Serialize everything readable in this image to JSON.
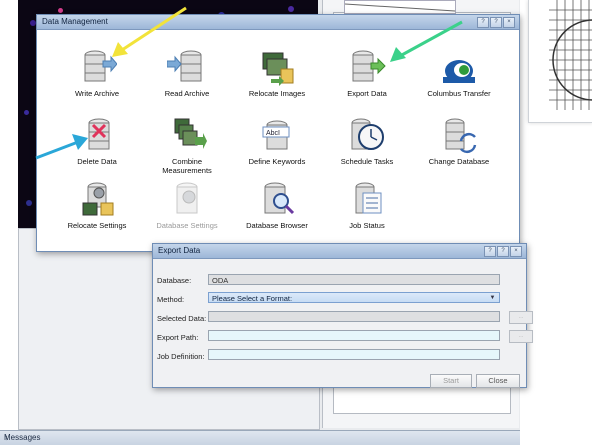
{
  "messages_bar": {
    "label": "Messages",
    "pin": "↑"
  },
  "data_management": {
    "title": "Data Management",
    "buttons": [
      "?",
      "?",
      "×"
    ],
    "tools": [
      {
        "label": "Write Archive",
        "icon": "write-archive-icon",
        "enabled": true
      },
      {
        "label": "Read Archive",
        "icon": "read-archive-icon",
        "enabled": true
      },
      {
        "label": "Relocate Images",
        "icon": "relocate-images-icon",
        "enabled": true
      },
      {
        "label": "Export Data",
        "icon": "export-data-icon",
        "enabled": true
      },
      {
        "label": "Columbus Transfer",
        "icon": "columbus-transfer-icon",
        "enabled": true
      },
      {
        "label": "Delete Data",
        "icon": "delete-data-icon",
        "enabled": true
      },
      {
        "label": "Combine Measurements",
        "icon": "combine-measurements-icon",
        "enabled": true
      },
      {
        "label": "Define Keywords",
        "icon": "define-keywords-icon",
        "enabled": true
      },
      {
        "label": "Schedule Tasks",
        "icon": "schedule-tasks-icon",
        "enabled": true
      },
      {
        "label": "Change Database",
        "icon": "change-database-icon",
        "enabled": true
      },
      {
        "label": "Relocate Settings",
        "icon": "relocate-settings-icon",
        "enabled": true
      },
      {
        "label": "Database Settings",
        "icon": "database-settings-icon",
        "enabled": false
      },
      {
        "label": "Database Browser",
        "icon": "database-browser-icon",
        "enabled": true
      },
      {
        "label": "Job Status",
        "icon": "job-status-icon",
        "enabled": true
      }
    ]
  },
  "export_dialog": {
    "title": "Export Data",
    "buttons": [
      "?",
      "?",
      "×"
    ],
    "database_label": "Database:",
    "database_value": "ODA",
    "method_label": "Method:",
    "method_value": "Please Select a Format:",
    "selected_data_label": "Selected Data:",
    "selected_data_value": "",
    "export_path_label": "Export Path:",
    "export_path_value": "",
    "job_definition_label": "Job Definition:",
    "job_definition_value": "",
    "side_button_label": "…",
    "start_label": "Start",
    "close_label": "Close"
  },
  "annotation_colors": {
    "yellow": "#f2e33a",
    "green": "#3bd18a",
    "cyan": "#2aa7d8"
  }
}
